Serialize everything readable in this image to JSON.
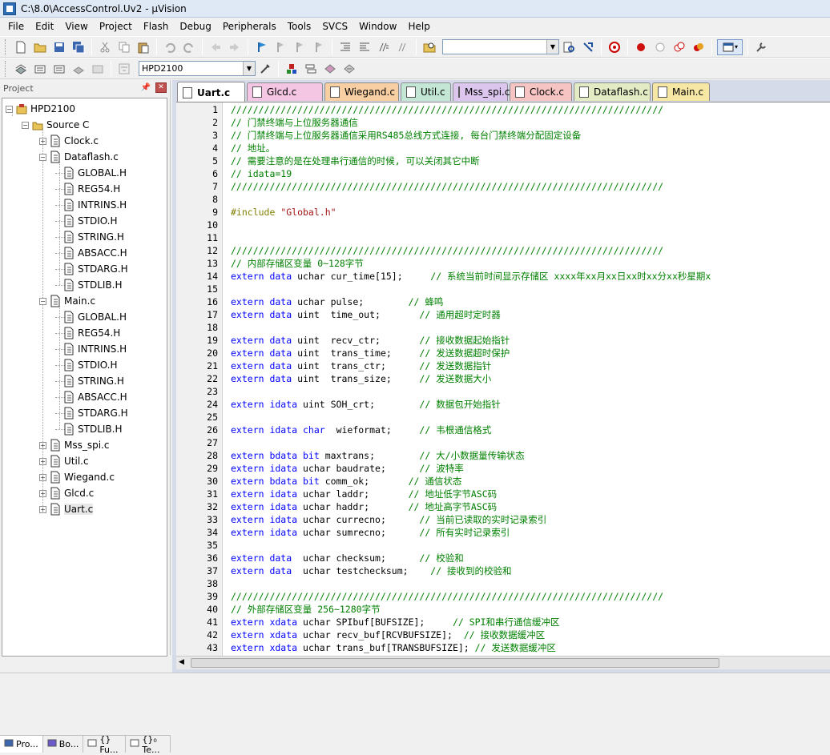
{
  "window": {
    "title": "C:\\8.0\\AccessControl.Uv2 - µVision"
  },
  "menu": [
    "File",
    "Edit",
    "View",
    "Project",
    "Flash",
    "Debug",
    "Peripherals",
    "Tools",
    "SVCS",
    "Window",
    "Help"
  ],
  "toolbar": {
    "target_select": "HPD2100",
    "find_combo": ""
  },
  "project_panel": {
    "title": "Project",
    "root": "HPD2100",
    "group": "Source C",
    "tree": [
      {
        "label": "Clock.c",
        "level": 2,
        "expand": "+"
      },
      {
        "label": "Dataflash.c",
        "level": 2,
        "expand": "-"
      },
      {
        "label": "GLOBAL.H",
        "level": 3
      },
      {
        "label": "REG54.H",
        "level": 3
      },
      {
        "label": "INTRINS.H",
        "level": 3
      },
      {
        "label": "STDIO.H",
        "level": 3
      },
      {
        "label": "STRING.H",
        "level": 3
      },
      {
        "label": "ABSACC.H",
        "level": 3
      },
      {
        "label": "STDARG.H",
        "level": 3
      },
      {
        "label": "STDLIB.H",
        "level": 3
      },
      {
        "label": "Main.c",
        "level": 2,
        "expand": "-"
      },
      {
        "label": "GLOBAL.H",
        "level": 3
      },
      {
        "label": "REG54.H",
        "level": 3
      },
      {
        "label": "INTRINS.H",
        "level": 3
      },
      {
        "label": "STDIO.H",
        "level": 3
      },
      {
        "label": "STRING.H",
        "level": 3
      },
      {
        "label": "ABSACC.H",
        "level": 3
      },
      {
        "label": "STDARG.H",
        "level": 3
      },
      {
        "label": "STDLIB.H",
        "level": 3
      },
      {
        "label": "Mss_spi.c",
        "level": 2,
        "expand": "+"
      },
      {
        "label": "Util.c",
        "level": 2,
        "expand": "+"
      },
      {
        "label": "Wiegand.c",
        "level": 2,
        "expand": "+"
      },
      {
        "label": "Glcd.c",
        "level": 2,
        "expand": "+"
      },
      {
        "label": "Uart.c",
        "level": 2,
        "expand": "+"
      }
    ],
    "bottom_tabs": [
      "Pro...",
      "Bo...",
      "{} Fu...",
      "{}₀ Te..."
    ]
  },
  "editor": {
    "tabs": [
      {
        "label": "Uart.c",
        "color": "#ffffff",
        "active": true
      },
      {
        "label": "Glcd.c",
        "color": "#f4c6e3"
      },
      {
        "label": "Wiegand.c",
        "color": "#f7cfa2"
      },
      {
        "label": "Util.c",
        "color": "#c3e7d4"
      },
      {
        "label": "Mss_spi.c",
        "color": "#dcc6ee"
      },
      {
        "label": "Clock.c",
        "color": "#f7c4c4"
      },
      {
        "label": "Dataflash.c",
        "color": "#e2ebc4"
      },
      {
        "label": "Main.c",
        "color": "#f7e7a5"
      }
    ],
    "lines": [
      [
        [
          "c",
          "//////////////////////////////////////////////////////////////////////////////"
        ]
      ],
      [
        [
          "c",
          "// 门禁终端与上位服务器通信"
        ]
      ],
      [
        [
          "c",
          "// 门禁终端与上位服务器通信采用RS485总线方式连接, 每台门禁终端分配固定设备"
        ]
      ],
      [
        [
          "c",
          "// 地址。"
        ]
      ],
      [
        [
          "c",
          "// 需要注意的是在处理串行通信的时候, 可以关闭其它中断"
        ]
      ],
      [
        [
          "c",
          "// idata=19"
        ]
      ],
      [
        [
          "c",
          "//////////////////////////////////////////////////////////////////////////////"
        ]
      ],
      [],
      [
        [
          "p",
          "#include "
        ],
        [
          "s",
          "\"Global.h\""
        ]
      ],
      [],
      [],
      [
        [
          "c",
          "//////////////////////////////////////////////////////////////////////////////"
        ]
      ],
      [
        [
          "c",
          "// 内部存储区变量 0~128字节"
        ]
      ],
      [
        [
          "k",
          "extern data "
        ],
        [
          "n",
          "uchar cur_time[15];     "
        ],
        [
          "c",
          "// 系统当前时间显示存储区 xxxx年xx月xx日xx时xx分xx秒星期x"
        ]
      ],
      [],
      [
        [
          "k",
          "extern data "
        ],
        [
          "n",
          "uchar pulse;        "
        ],
        [
          "c",
          "// 蜂鸣"
        ]
      ],
      [
        [
          "k",
          "extern data "
        ],
        [
          "n",
          "uint  time_out;       "
        ],
        [
          "c",
          "// 通用超时定时器"
        ]
      ],
      [],
      [
        [
          "k",
          "extern data "
        ],
        [
          "n",
          "uint  recv_ctr;       "
        ],
        [
          "c",
          "// 接收数据起始指针"
        ]
      ],
      [
        [
          "k",
          "extern data "
        ],
        [
          "n",
          "uint  trans_time;     "
        ],
        [
          "c",
          "// 发送数据超时保护"
        ]
      ],
      [
        [
          "k",
          "extern data "
        ],
        [
          "n",
          "uint  trans_ctr;      "
        ],
        [
          "c",
          "// 发送数据指针"
        ]
      ],
      [
        [
          "k",
          "extern data "
        ],
        [
          "n",
          "uint  trans_size;     "
        ],
        [
          "c",
          "// 发送数据大小"
        ]
      ],
      [],
      [
        [
          "k",
          "extern idata "
        ],
        [
          "n",
          "uint SOH_crt;        "
        ],
        [
          "c",
          "// 数据包开始指针"
        ]
      ],
      [],
      [
        [
          "k",
          "extern idata char  "
        ],
        [
          "n",
          "wieformat;     "
        ],
        [
          "c",
          "// 韦根通信格式"
        ]
      ],
      [],
      [
        [
          "k",
          "extern bdata bit "
        ],
        [
          "n",
          "maxtrans;        "
        ],
        [
          "c",
          "// 大/小数据量传输状态"
        ]
      ],
      [
        [
          "k",
          "extern idata "
        ],
        [
          "n",
          "uchar baudrate;      "
        ],
        [
          "c",
          "// 波特率"
        ]
      ],
      [
        [
          "k",
          "extern bdata bit "
        ],
        [
          "n",
          "comm_ok;       "
        ],
        [
          "c",
          "// 通信状态"
        ]
      ],
      [
        [
          "k",
          "extern idata "
        ],
        [
          "n",
          "uchar laddr;       "
        ],
        [
          "c",
          "// 地址低字节ASC码"
        ]
      ],
      [
        [
          "k",
          "extern idata "
        ],
        [
          "n",
          "uchar haddr;       "
        ],
        [
          "c",
          "// 地址高字节ASC码"
        ]
      ],
      [
        [
          "k",
          "extern idata "
        ],
        [
          "n",
          "uchar currecno;      "
        ],
        [
          "c",
          "// 当前已读取的实时记录索引"
        ]
      ],
      [
        [
          "k",
          "extern idata "
        ],
        [
          "n",
          "uchar sumrecno;      "
        ],
        [
          "c",
          "// 所有实时记录索引"
        ]
      ],
      [],
      [
        [
          "k",
          "extern data  "
        ],
        [
          "n",
          "uchar checksum;      "
        ],
        [
          "c",
          "// 校验和"
        ]
      ],
      [
        [
          "k",
          "extern data  "
        ],
        [
          "n",
          "uchar testchecksum;    "
        ],
        [
          "c",
          "// 接收到的校验和"
        ]
      ],
      [],
      [
        [
          "c",
          "//////////////////////////////////////////////////////////////////////////////"
        ]
      ],
      [
        [
          "c",
          "// 外部存储区变量 256~1280字节"
        ]
      ],
      [
        [
          "k",
          "extern xdata "
        ],
        [
          "n",
          "uchar SPIbuf[BUFSIZE];     "
        ],
        [
          "c",
          "// SPI和串行通信缓冲区"
        ]
      ],
      [
        [
          "k",
          "extern xdata "
        ],
        [
          "n",
          "uchar recv_buf[RCVBUFSIZE];  "
        ],
        [
          "c",
          "// 接收数据缓冲区"
        ]
      ],
      [
        [
          "k",
          "extern xdata "
        ],
        [
          "n",
          "uchar trans_buf[TRANSBUFSIZE]; "
        ],
        [
          "c",
          "// 发送数据缓冲区"
        ]
      ]
    ]
  },
  "colors": {
    "keyword": "#0000ff",
    "comment": "#008000",
    "preprocessor": "#808000",
    "string": "#a31515"
  }
}
